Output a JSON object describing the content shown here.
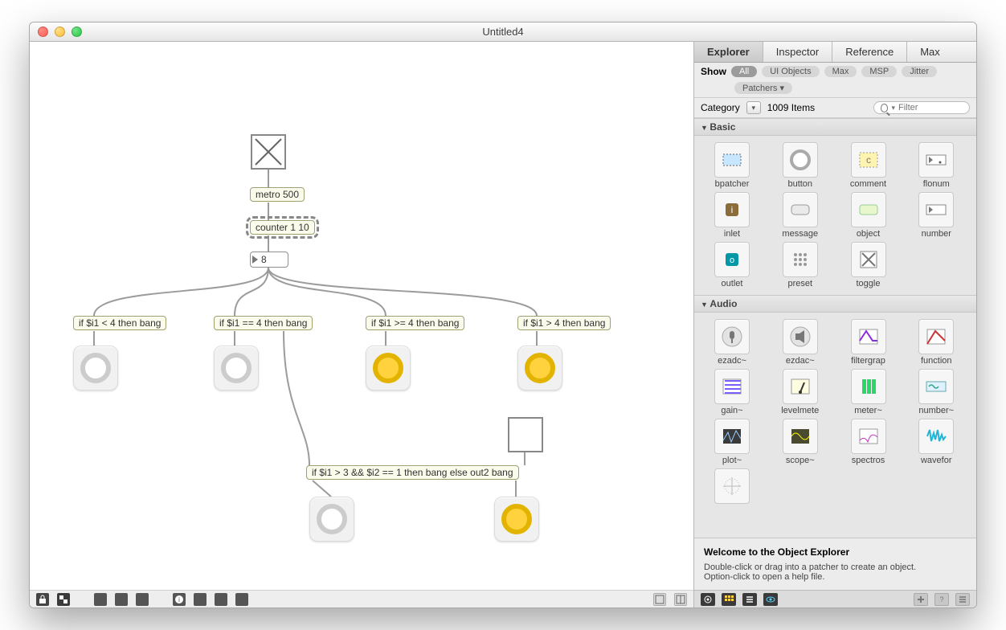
{
  "window": {
    "title": "Untitled4"
  },
  "patch": {
    "objects": {
      "metro": "metro 500",
      "counter": "counter 1 10",
      "number": "8",
      "if_lt4": "if $i1 < 4 then bang",
      "if_eq4": "if $i1 == 4 then bang",
      "if_ge4": "if $i1 >= 4 then bang",
      "if_gt4": "if $i1 > 4 then bang",
      "if_combo": "if $i1 > 3 && $i2 == 1 then bang else out2 bang"
    }
  },
  "side": {
    "tabs": [
      "Explorer",
      "Inspector",
      "Reference",
      "Max"
    ],
    "active_tab": 0,
    "show_label": "Show",
    "filters": [
      "All",
      "UI Objects",
      "Max",
      "MSP",
      "Jitter"
    ],
    "filters_row2": [
      "Patchers"
    ],
    "category_label": "Category",
    "item_count": "1009 Items",
    "search_placeholder": "Filter",
    "sections": {
      "basic": {
        "title": "Basic",
        "items": [
          "bpatcher",
          "button",
          "comment",
          "flonum",
          "inlet",
          "message",
          "object",
          "number",
          "outlet",
          "preset",
          "toggle"
        ]
      },
      "audio": {
        "title": "Audio",
        "items": [
          "ezadc~",
          "ezdac~",
          "filtergrap",
          "function",
          "gain~",
          "levelmete",
          "meter~",
          "number~",
          "plot~",
          "scope~",
          "spectros",
          "wavefor"
        ]
      }
    },
    "welcome": {
      "title": "Welcome to the Object Explorer",
      "line1": "Double-click or drag into a patcher to create an object.",
      "line2": "Option-click to open a help file."
    }
  }
}
